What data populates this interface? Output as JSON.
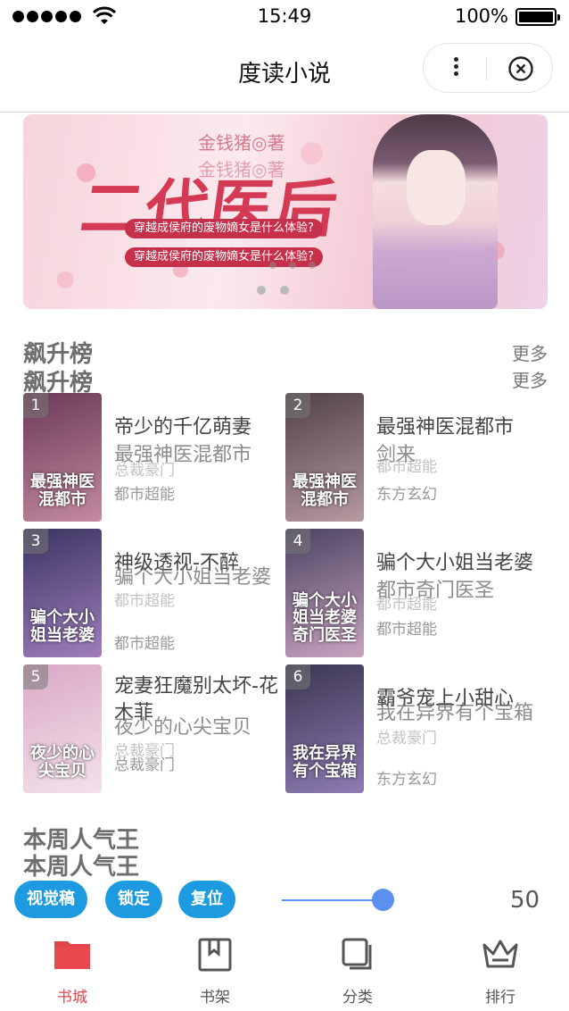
{
  "status_bar": {
    "time": "15:49",
    "battery": "100%"
  },
  "nav": {
    "title": "度读小说"
  },
  "banner": {
    "author": "金钱猪◎著",
    "title": "二代医后",
    "tag1": "穿越成侯府的废物嫡女是什么体验?",
    "tag2": "穿越成侯府的废物嫡女是什么体验?"
  },
  "section1": {
    "title": "飙升榜",
    "more": "更多",
    "books": [
      {
        "rank": "1",
        "name": "帝少的千亿萌妻",
        "name_overlay": "最强神医混都市",
        "genre_ghost": "总裁豪门",
        "genre": "都市超能",
        "cover_text": "最强神医混都市",
        "cover_color1": "#6a3a55",
        "cover_color2": "#c48aa0"
      },
      {
        "rank": "2",
        "name": "最强神医混都市",
        "name_overlay": "剑来",
        "genre_ghost": "都市超能",
        "genre": "东方玄幻",
        "cover_text": "最强神医混都市",
        "cover_color1": "#514148",
        "cover_color2": "#b69aa0"
      },
      {
        "rank": "3",
        "name": "神级透视-不醉",
        "name_overlay": "骗个大小姐当老婆",
        "genre_ghost": "都市超能",
        "genre": "都市超能",
        "cover_text": "骗个大小姐当老婆",
        "cover_color1": "#3a3560",
        "cover_color2": "#a07dbd"
      },
      {
        "rank": "4",
        "name": "骗个大小姐当老婆",
        "name_overlay": "都市奇门医圣",
        "genre_ghost": "都市超能",
        "genre": "都市超能",
        "cover_text": "骗个大小姐当老婆 奇门医圣",
        "cover_color1": "#4a4360",
        "cover_color2": "#c9a3c0"
      },
      {
        "rank": "5",
        "name": "宠妻狂魔别太坏-花木菲",
        "name_overlay": "夜少的心尖宝贝",
        "genre_ghost": "总裁豪门",
        "genre": "总裁豪门",
        "cover_text": "夜少的心尖宝贝",
        "cover_color1": "#d9a9c4",
        "cover_color2": "#f4e1ea"
      },
      {
        "rank": "6",
        "name": "霸爷宠上小甜心",
        "name_overlay": "我在异界有个宝箱",
        "genre_ghost": "总裁豪门",
        "genre": "东方玄幻",
        "cover_text": "我在异界有个宝箱",
        "cover_color1": "#3b3550",
        "cover_color2": "#8d7cb3"
      }
    ]
  },
  "section2": {
    "title": "本周人气王"
  },
  "debug": {
    "btn1": "视觉稿",
    "btn2": "锁定",
    "btn3": "复位",
    "slider_value": "50",
    "slider_level": 0.5
  },
  "tabs": [
    {
      "label": "书城",
      "icon": "bookstore-icon",
      "active": true
    },
    {
      "label": "书架",
      "icon": "bookshelf-icon",
      "active": false
    },
    {
      "label": "分类",
      "icon": "category-icon",
      "active": false
    },
    {
      "label": "排行",
      "icon": "ranking-crown-icon",
      "active": false
    }
  ],
  "colors": {
    "accent": "#e2454a",
    "debug_blue": "#1e9be0",
    "slider": "#5b8ff0"
  }
}
